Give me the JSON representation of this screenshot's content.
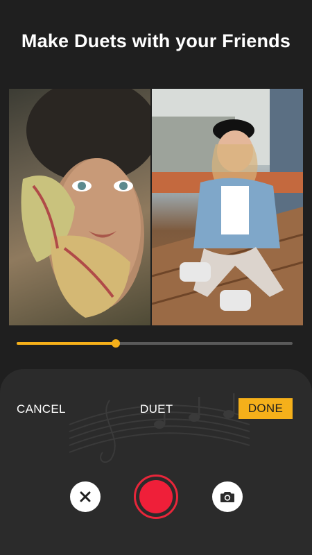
{
  "header": {
    "title": "Make Duets with your Friends"
  },
  "media": {
    "left_photo": "portrait-with-flowers",
    "right_photo": "girl-sitting-on-bench"
  },
  "timeline": {
    "progress": 0.36
  },
  "controls": {
    "cancel_label": "CANCEL",
    "mode_label": "DUET",
    "done_label": "DONE"
  },
  "icons": {
    "close": "close-icon",
    "record": "record-icon",
    "camera": "camera-icon",
    "background": "music-notes-icon"
  },
  "colors": {
    "accent": "#f5b01a",
    "record": "#ef1f39",
    "background": "#1f1f1f",
    "panel": "#2b2b2b"
  }
}
